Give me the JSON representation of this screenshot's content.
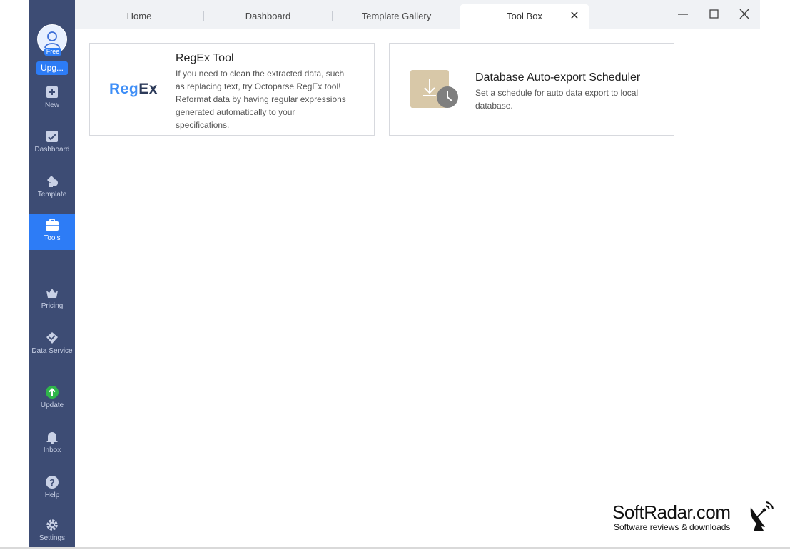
{
  "user": {
    "badge": "Free",
    "upgrade_label": "Upg..."
  },
  "sidebar": {
    "items": [
      {
        "label": "New",
        "icon": "plus-square-icon"
      },
      {
        "label": "Dashboard",
        "icon": "dashboard-icon"
      },
      {
        "label": "Template",
        "icon": "template-icon"
      },
      {
        "label": "Tools",
        "icon": "toolbox-icon",
        "active": true
      },
      {
        "label": "Pricing",
        "icon": "crown-icon"
      },
      {
        "label": "Data Service",
        "icon": "diamond-check-icon"
      },
      {
        "label": "Update",
        "icon": "upload-circle-icon"
      },
      {
        "label": "Inbox",
        "icon": "bell-icon"
      },
      {
        "label": "Help",
        "icon": "help-circle-icon"
      },
      {
        "label": "Settings",
        "icon": "gear-icon"
      }
    ]
  },
  "tabs": [
    {
      "label": "Home"
    },
    {
      "label": "Dashboard"
    },
    {
      "label": "Template Gallery"
    },
    {
      "label": "Tool Box",
      "active": true
    }
  ],
  "tools": [
    {
      "logo_part1": "Reg",
      "logo_part2": "Ex",
      "title": "RegEx Tool",
      "description": "If you need to clean the extracted data, such as replacing text, try Octoparse RegEx tool! Reformat data by having regular expressions generated automatically to your specifications."
    },
    {
      "icon": "download-clock-icon",
      "title": "Database Auto-export Scheduler",
      "description": "Set a schedule for auto data export to local database."
    }
  ],
  "watermark": {
    "name": "SoftRadar.com",
    "tagline": "Software reviews & downloads"
  },
  "colors": {
    "sidebar": "#3d4c74",
    "accent": "#2d7cf6",
    "update_green": "#2fb54a",
    "regex_blue": "#3e8ef7",
    "regex_dark": "#2c3a59",
    "scheduler_tile": "#d8c8a8"
  }
}
